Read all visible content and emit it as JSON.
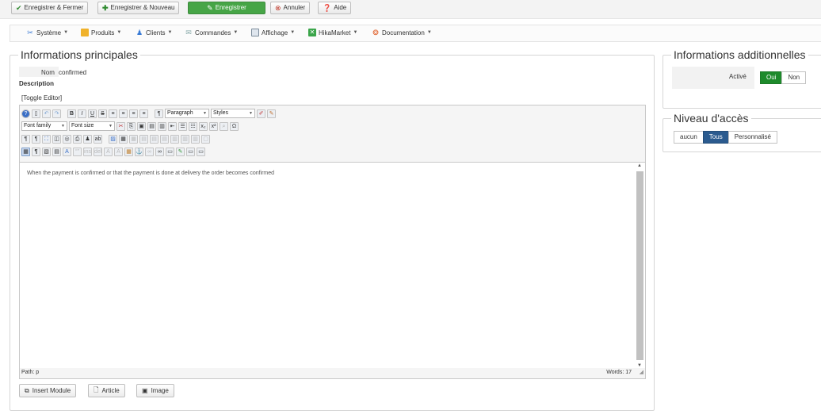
{
  "toolbar": {
    "save_close": "Enregistrer & Fermer",
    "save_new": "Enregistrer & Nouveau",
    "save": "Enregistrer",
    "cancel": "Annuler",
    "help": "Aide"
  },
  "menu": {
    "items": [
      "Système",
      "Produits",
      "Clients",
      "Commandes",
      "Affichage",
      "HikaMarket",
      "Documentation"
    ]
  },
  "main": {
    "legend": "Informations principales",
    "name_label": "Nom",
    "name_value": "confirmed",
    "description_label": "Description",
    "toggle_editor": "[Toggle Editor]"
  },
  "editor": {
    "format_select": "Paragraph",
    "styles_select": "Styles",
    "font_family": "Font family",
    "font_size": "Font size",
    "content": "When the payment is confirmed or that the payment is done at delivery the order becomes confirmed",
    "path": "Path:  p",
    "words": "Words: 17"
  },
  "bottom_buttons": {
    "insert_module": "Insert Module",
    "article": "Article",
    "image": "Image"
  },
  "additional": {
    "legend": "Informations additionnelles",
    "active_label": "Activé",
    "yes": "Oui",
    "no": "Non"
  },
  "access": {
    "legend": "Niveau d'accès",
    "none": "aucun",
    "all": "Tous",
    "custom": "Personnalisé"
  },
  "colors": {
    "save_green": "#46a546",
    "active_green": "#1d8a2b",
    "selected_blue": "#2b5b8f"
  }
}
